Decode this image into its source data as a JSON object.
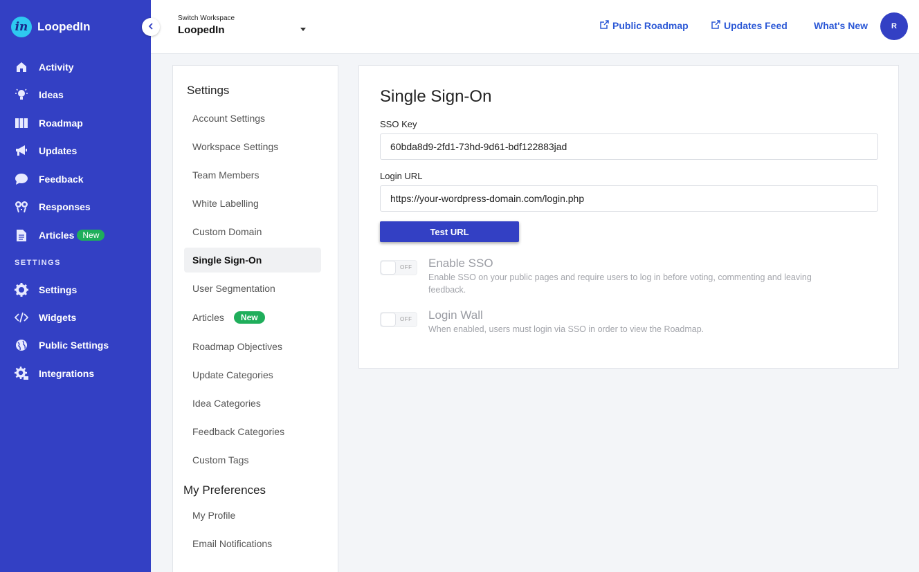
{
  "brand": {
    "name": "LoopedIn",
    "logo_text": "in"
  },
  "sidebar": {
    "items": [
      {
        "label": "Activity",
        "icon": "home-icon"
      },
      {
        "label": "Ideas",
        "icon": "lightbulb-icon"
      },
      {
        "label": "Roadmap",
        "icon": "roadmap-columns-icon"
      },
      {
        "label": "Updates",
        "icon": "megaphone-icon"
      },
      {
        "label": "Feedback",
        "icon": "chat-bubble-icon"
      },
      {
        "label": "Responses",
        "icon": "responses-icon"
      },
      {
        "label": "Articles",
        "icon": "document-icon",
        "badge": "New"
      }
    ],
    "section_label": "SETTINGS",
    "settings_items": [
      {
        "label": "Settings",
        "icon": "gear-icon"
      },
      {
        "label": "Widgets",
        "icon": "code-icon"
      },
      {
        "label": "Public Settings",
        "icon": "globe-icon"
      },
      {
        "label": "Integrations",
        "icon": "integrations-gear-icon"
      }
    ]
  },
  "topbar": {
    "workspace_label": "Switch Workspace",
    "workspace_name": "LoopedIn",
    "links": [
      "Public Roadmap",
      "Updates Feed",
      "What's New"
    ],
    "avatar_initial": "R"
  },
  "settings_nav": {
    "heading": "Settings",
    "items": [
      {
        "label": "Account Settings"
      },
      {
        "label": "Workspace Settings"
      },
      {
        "label": "Team Members"
      },
      {
        "label": "White Labelling"
      },
      {
        "label": "Custom Domain"
      },
      {
        "label": "Single Sign-On",
        "active": true
      },
      {
        "label": "User Segmentation"
      },
      {
        "label": "Articles",
        "badge": "New"
      },
      {
        "label": "Roadmap Objectives"
      },
      {
        "label": "Update Categories"
      },
      {
        "label": "Idea Categories"
      },
      {
        "label": "Feedback Categories"
      },
      {
        "label": "Custom Tags"
      }
    ],
    "preferences_heading": "My Preferences",
    "preferences_items": [
      "My Profile",
      "Email Notifications"
    ]
  },
  "sso": {
    "title": "Single Sign-On",
    "sso_key_label": "SSO Key",
    "sso_key_value": "60bda8d9-2fd1-73hd-9d61-bdf122883jad",
    "login_url_label": "Login URL",
    "login_url_value": "https://your-wordpress-domain.com/login.php",
    "test_button": "Test URL",
    "toggles": [
      {
        "state": "OFF",
        "title": "Enable SSO",
        "description": "Enable SSO on your public pages and require users to log in before voting, commenting and leaving feedback."
      },
      {
        "state": "OFF",
        "title": "Login Wall",
        "description": "When enabled, users must login via SSO in order to view the Roadmap."
      }
    ]
  },
  "colors": {
    "sidebar": "#3340c4",
    "link": "#2b58d6",
    "badge": "#1fae5b",
    "logo": "#2ec9f0"
  }
}
